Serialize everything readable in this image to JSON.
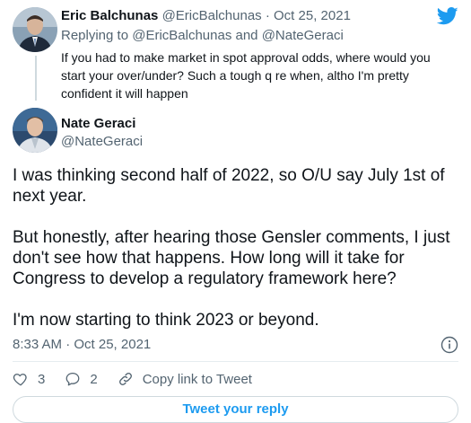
{
  "reply_tweet": {
    "author_name": "Eric Balchunas",
    "author_handle": "@EricBalchunas",
    "separator": "·",
    "date": "Oct 25, 2021",
    "replying_prefix": "Replying to",
    "replying_handle_1": "@EricBalchunas",
    "replying_and": "and",
    "replying_handle_2": "@NateGeraci",
    "text": "If you had to make market in spot approval odds, where would you start your over/under? Such a tough q re when, altho I'm pretty confident it will happen"
  },
  "main_tweet": {
    "author_name": "Nate Geraci",
    "author_handle": "@NateGeraci",
    "paragraphs": [
      "I was thinking second half of 2022, so O/U say July 1st of next year.",
      "But honestly, after hearing those Gensler comments, I just don't see how that happens. How long will it take for Congress to develop a regulatory framework here?",
      "I'm now starting to think 2023 or beyond."
    ],
    "timestamp": "8:33 AM · Oct 25, 2021"
  },
  "actions": {
    "like_count": "3",
    "reply_count": "2",
    "copy_link_label": "Copy link to Tweet"
  },
  "reply_button_label": "Tweet your reply",
  "icons": {
    "brand": "twitter-bird-icon",
    "info": "info-icon",
    "like": "heart-icon",
    "reply": "comment-icon",
    "copy_link": "link-icon"
  },
  "colors": {
    "brand_blue": "#1d9bf0",
    "text_primary": "#0f1419",
    "text_secondary": "#536471",
    "border": "#cfd9de"
  }
}
